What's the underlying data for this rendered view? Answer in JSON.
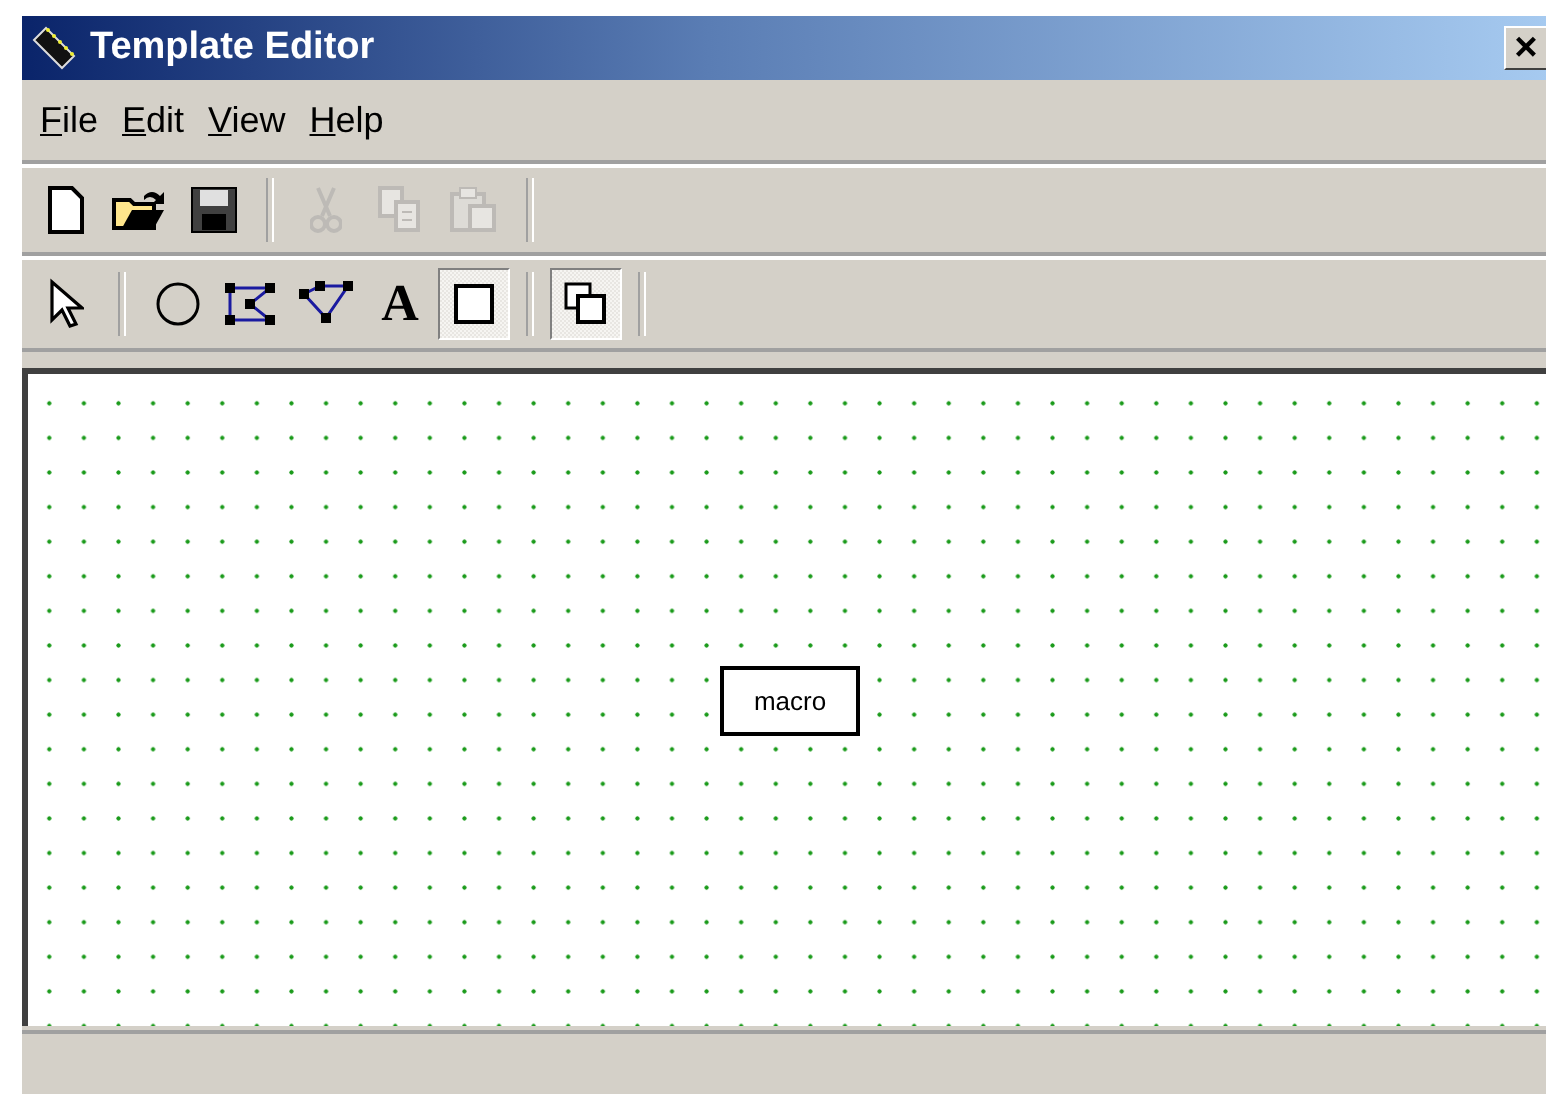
{
  "window": {
    "title": "Template Editor",
    "close": "×"
  },
  "menu": [
    {
      "label": "File"
    },
    {
      "label": "Edit"
    },
    {
      "label": "View"
    },
    {
      "label": "Help"
    }
  ],
  "file_toolbar": [
    {
      "kind": "new",
      "disabled": false
    },
    {
      "kind": "open",
      "disabled": false
    },
    {
      "kind": "save",
      "disabled": false
    },
    {
      "kind": "separator"
    },
    {
      "kind": "cut",
      "disabled": true
    },
    {
      "kind": "copy",
      "disabled": true
    },
    {
      "kind": "paste",
      "disabled": true
    },
    {
      "kind": "separator"
    }
  ],
  "draw_toolbar": [
    {
      "kind": "pointer",
      "selected": false
    },
    {
      "kind": "separator"
    },
    {
      "kind": "ellipse",
      "selected": false
    },
    {
      "kind": "polygon",
      "selected": false
    },
    {
      "kind": "polyline",
      "selected": false
    },
    {
      "kind": "text",
      "glyph": "A",
      "selected": false
    },
    {
      "kind": "rectangle",
      "selected": true
    },
    {
      "kind": "separator"
    },
    {
      "kind": "front",
      "selected": true
    },
    {
      "kind": "separator"
    }
  ],
  "canvas": {
    "shapes": [
      {
        "kind": "box",
        "label": "macro"
      }
    ]
  }
}
